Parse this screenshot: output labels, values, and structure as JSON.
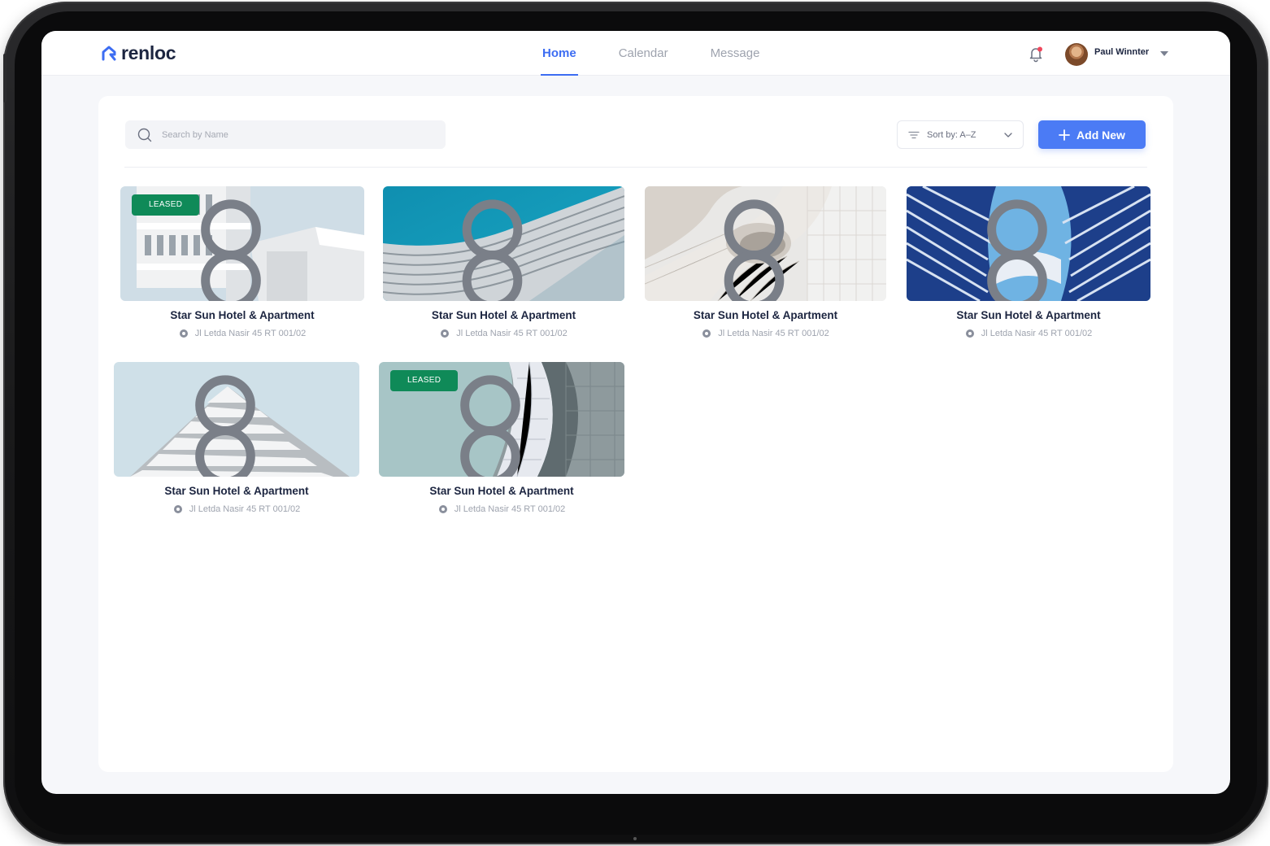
{
  "app": {
    "name": "renloc",
    "brand_color": "#3d6df2"
  },
  "nav": {
    "items": [
      {
        "label": "Home",
        "active": true
      },
      {
        "label": "Calendar",
        "active": false
      },
      {
        "label": "Message",
        "active": false
      }
    ]
  },
  "header": {
    "notification_icon": "bell-icon",
    "user": {
      "name": "Paul Winnter"
    }
  },
  "toolbar": {
    "search_placeholder": "Search by Name",
    "sort_label": "Sort by: A–Z",
    "add_label": "Add New"
  },
  "properties": [
    {
      "title": "Star Sun Hotel & Apartment",
      "address": "Jl Letda Nasir 45 RT 001/02",
      "badge": "LEASED"
    },
    {
      "title": "Star Sun Hotel & Apartment",
      "address": "Jl Letda Nasir 45 RT 001/02",
      "badge": ""
    },
    {
      "title": "Star Sun Hotel & Apartment",
      "address": "Jl Letda Nasir 45 RT 001/02",
      "badge": ""
    },
    {
      "title": "Star Sun Hotel & Apartment",
      "address": "Jl Letda Nasir 45 RT 001/02",
      "badge": ""
    },
    {
      "title": "Star Sun Hotel & Apartment",
      "address": "Jl Letda Nasir 45 RT 001/02",
      "badge": ""
    },
    {
      "title": "Star Sun Hotel & Apartment",
      "address": "Jl Letda Nasir 45 RT 001/02",
      "badge": "LEASED"
    }
  ],
  "colors": {
    "leased_badge": "#0f8a58",
    "add_button": "#4b7bf5",
    "title": "#1c2540",
    "muted": "#9ea3ae"
  }
}
